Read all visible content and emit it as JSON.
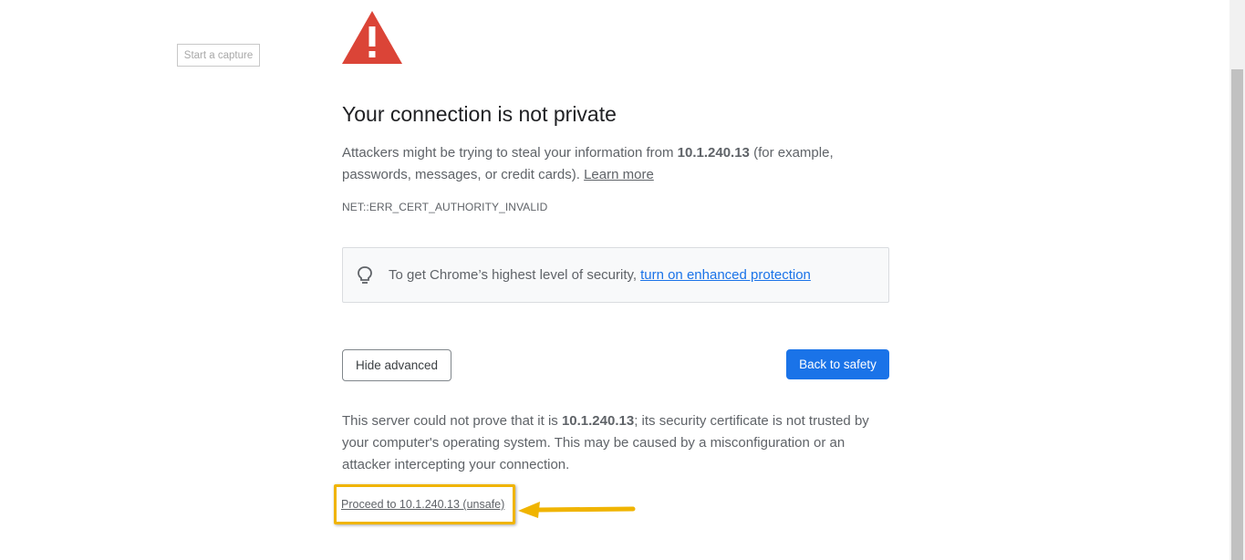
{
  "capture": {
    "label": "Start a capture"
  },
  "heading": {
    "title": "Your connection is not private"
  },
  "intro": {
    "prefix": "Attackers might be trying to steal your information from ",
    "host": "10.1.240.13",
    "suffix": " (for example, passwords, messages, or credit cards). ",
    "learn_more": "Learn more"
  },
  "error_code": "NET::ERR_CERT_AUTHORITY_INVALID",
  "enhanced": {
    "text": "To get Chrome’s highest level of security,",
    "link": "turn on enhanced protection",
    "icon": "lightbulb-icon"
  },
  "buttons": {
    "hide_advanced": "Hide advanced",
    "back_to_safety": "Back to safety"
  },
  "details": {
    "prefix": "This server could not prove that it is ",
    "host": "10.1.240.13",
    "suffix": "; its security certificate is not trusted by your computer's operating system. This may be caused by a misconfiguration or an attacker intercepting your connection."
  },
  "proceed": {
    "label": "Proceed to 10.1.240.13 (unsafe)"
  },
  "colors": {
    "warning_red": "#db4437",
    "primary_blue": "#1a73e8",
    "annotation_yellow": "#f0b400"
  },
  "icons": {
    "warning": "warning-triangle-icon",
    "annotation_arrow": "arrow-left-icon"
  }
}
